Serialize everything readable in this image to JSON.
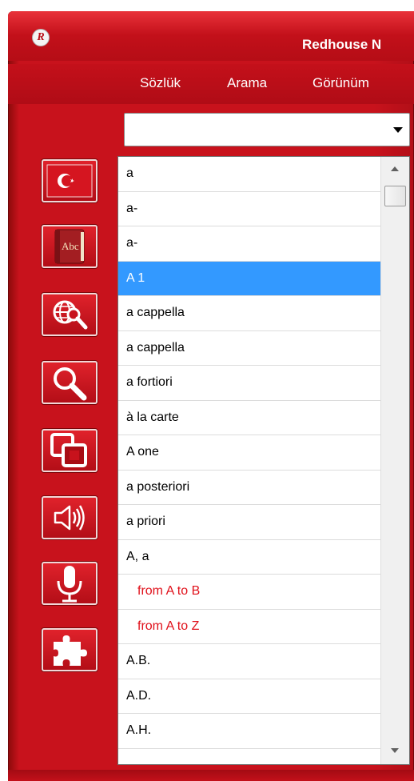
{
  "window": {
    "title": "Redhouse N",
    "logo_letter": "R"
  },
  "menu": {
    "items": [
      "Sözlük",
      "Arama",
      "Görünüm"
    ]
  },
  "search_combo": {
    "value": ""
  },
  "sidebar": {
    "buttons": [
      {
        "name": "turkish-flag-icon",
        "label": "C*"
      },
      {
        "name": "abc-book-icon",
        "label": "Abc"
      },
      {
        "name": "globe-search-icon"
      },
      {
        "name": "magnifier-icon"
      },
      {
        "name": "copy-squares-icon"
      },
      {
        "name": "speaker-icon"
      },
      {
        "name": "microphone-icon"
      },
      {
        "name": "puzzle-icon"
      }
    ]
  },
  "word_list": {
    "rows": [
      {
        "text": "a",
        "style": "normal"
      },
      {
        "text": "a-",
        "style": "normal"
      },
      {
        "text": "a-",
        "style": "normal"
      },
      {
        "text": "A 1",
        "style": "selected"
      },
      {
        "text": "a cappella",
        "style": "normal"
      },
      {
        "text": "a cappella",
        "style": "normal"
      },
      {
        "text": "a fortiori",
        "style": "normal"
      },
      {
        "text": "à la carte",
        "style": "normal"
      },
      {
        "text": "A one",
        "style": "normal"
      },
      {
        "text": "a posteriori",
        "style": "normal"
      },
      {
        "text": "a priori",
        "style": "normal"
      },
      {
        "text": "A, a",
        "style": "normal"
      },
      {
        "text": "from A to B",
        "style": "red"
      },
      {
        "text": "from A to Z",
        "style": "red"
      },
      {
        "text": "A.B.",
        "style": "normal"
      },
      {
        "text": "A.D.",
        "style": "normal"
      },
      {
        "text": "A.H.",
        "style": "normal"
      }
    ]
  },
  "colors": {
    "frame_red": "#c8121c",
    "selection_blue": "#3399ff",
    "phrase_red": "#e0101a"
  }
}
